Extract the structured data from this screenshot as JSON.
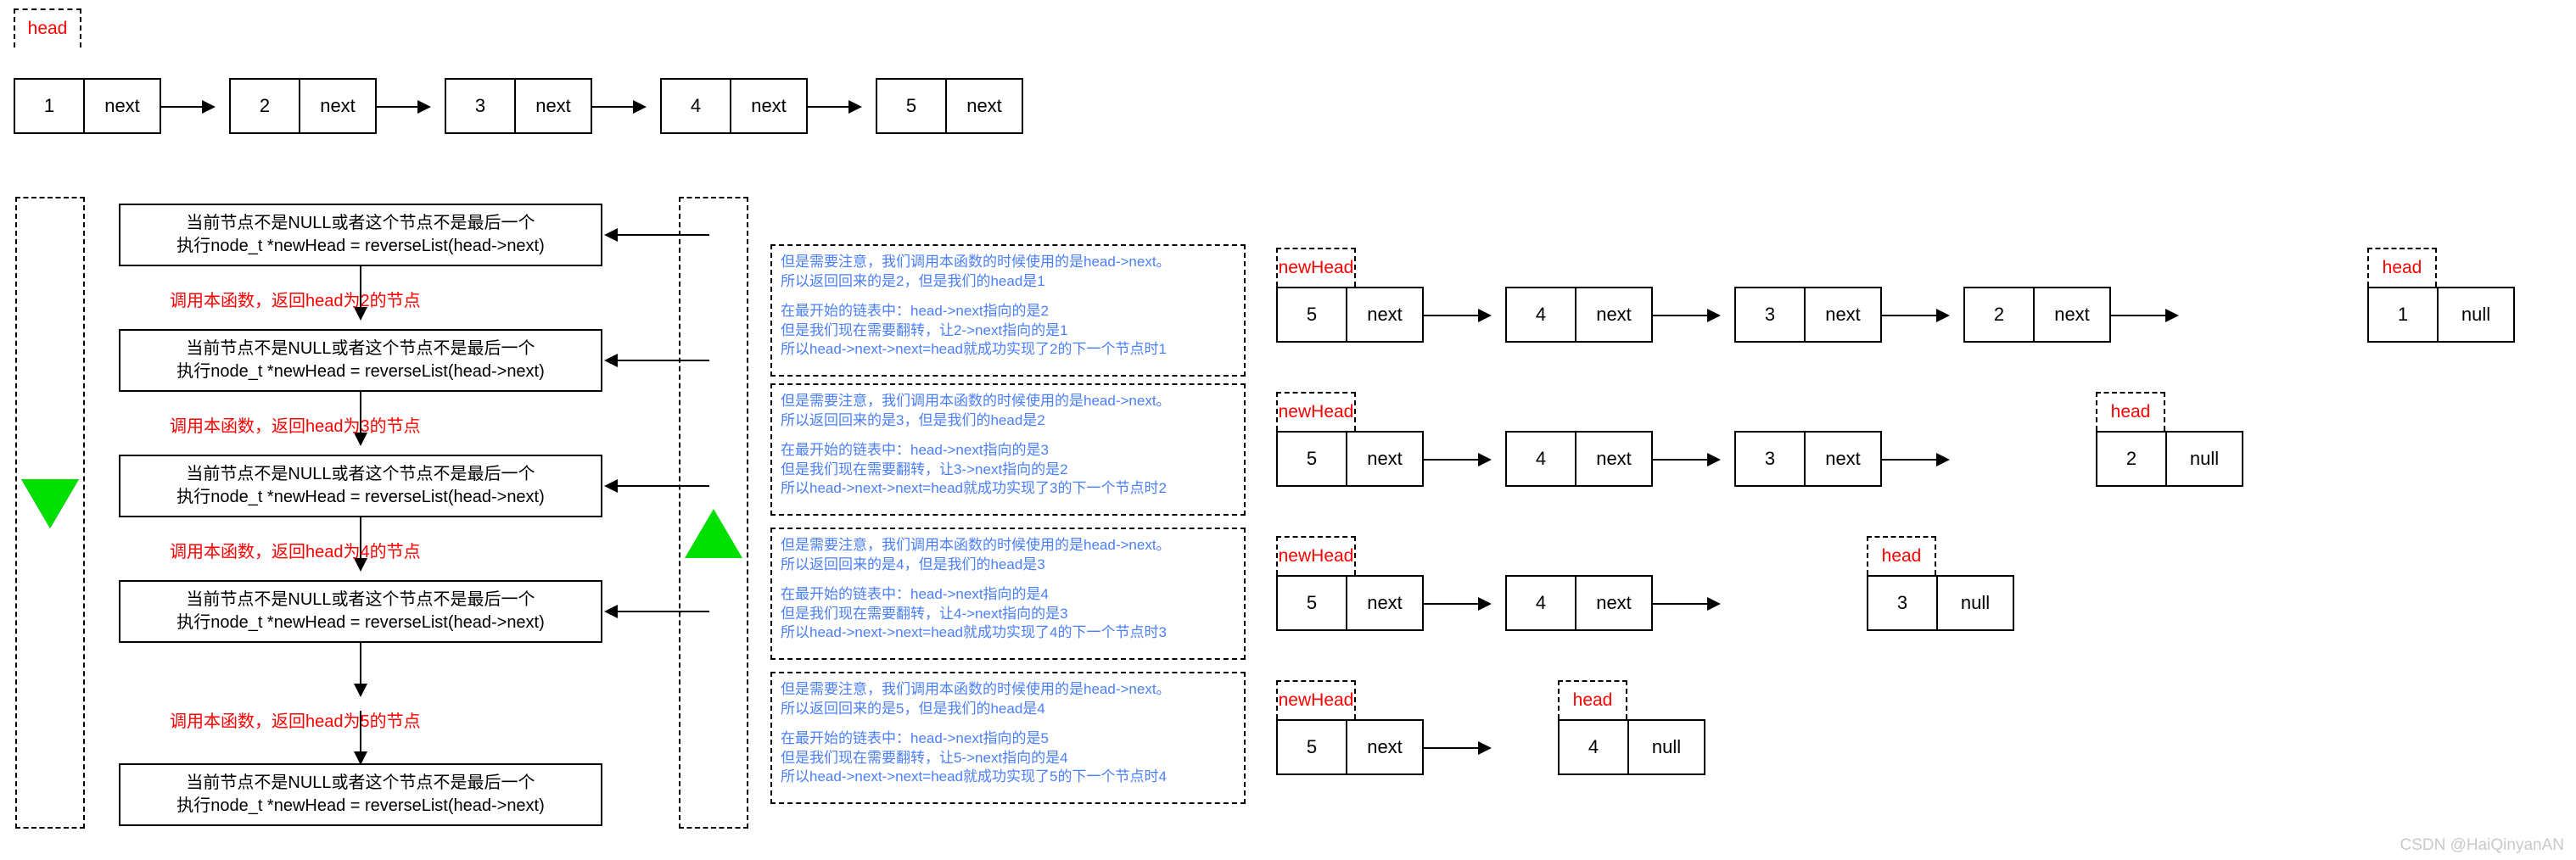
{
  "title": "reverseList recursion diagram",
  "colors": {
    "pointer_label": "#ff0000",
    "note_text": "#4a7ffb",
    "triangle": "#00e000",
    "outline": "#000000",
    "watermark": "#c9c9c9"
  },
  "top_list": {
    "pointer_label": "head",
    "nodes": [
      {
        "value": "1",
        "next": "next"
      },
      {
        "value": "2",
        "next": "next"
      },
      {
        "value": "3",
        "next": "next"
      },
      {
        "value": "4",
        "next": "next"
      },
      {
        "value": "5",
        "next": "next"
      }
    ]
  },
  "recursion": {
    "direction_icon_down": "triangle-down",
    "direction_icon_up": "triangle-up",
    "steps": [
      {
        "line1": "当前节点不是NULL或者这个节点不是最后一个",
        "line2": "执行node_t *newHead = reverseList(head->next)"
      },
      {
        "line1": "当前节点不是NULL或者这个节点不是最后一个",
        "line2": "执行node_t *newHead = reverseList(head->next)"
      },
      {
        "line1": "当前节点不是NULL或者这个节点不是最后一个",
        "line2": "执行node_t *newHead = reverseList(head->next)"
      },
      {
        "line1": "当前节点不是NULL或者这个节点不是最后一个",
        "line2": "执行node_t *newHead = reverseList(head->next)"
      },
      {
        "line1": "当前节点不是NULL或者这个节点不是最后一个",
        "line2": "执行node_t *newHead = reverseList(head->next)"
      }
    ],
    "transitions": [
      "调用本函数，返回head为2的节点",
      "调用本函数，返回head为3的节点",
      "调用本函数，返回head为4的节点",
      "调用本函数，返回head为5的节点"
    ]
  },
  "notes": [
    {
      "l1": "但是需要注意，我们调用本函数的时候使用的是head->next。",
      "l2": "所以返回回来的是2，但是我们的head是1",
      "l3": "在最开始的链表中：head->next指向的是2",
      "l4": "但是我们现在需要翻转，让2->next指向的是1",
      "l5": "所以head->next->next=head就成功实现了2的下一个节点时1"
    },
    {
      "l1": "但是需要注意，我们调用本函数的时候使用的是head->next。",
      "l2": "所以返回回来的是3，但是我们的head是2",
      "l3": "在最开始的链表中：head->next指向的是3",
      "l4": "但是我们现在需要翻转，让3->next指向的是2",
      "l5": "所以head->next->next=head就成功实现了3的下一个节点时2"
    },
    {
      "l1": "但是需要注意，我们调用本函数的时候使用的是head->next。",
      "l2": "所以返回回来的是4，但是我们的head是3",
      "l3": "在最开始的链表中：head->next指向的是4",
      "l4": "但是我们现在需要翻转，让4->next指向的是3",
      "l5": "所以head->next->next=head就成功实现了4的下一个节点时3"
    },
    {
      "l1": "但是需要注意，我们调用本函数的时候使用的是head->next。",
      "l2": "所以返回回来的是5，但是我们的head是4",
      "l3": "在最开始的链表中：head->next指向的是5",
      "l4": "但是我们现在需要翻转，让5->next指向的是4",
      "l5": "所以head->next->next=head就成功实现了5的下一个节点时4"
    }
  ],
  "result_lists": [
    {
      "new_head_label": "newHead",
      "head_label": "head",
      "nodes": [
        {
          "value": "5",
          "next": "next"
        },
        {
          "value": "4",
          "next": "next"
        },
        {
          "value": "3",
          "next": "next"
        },
        {
          "value": "2",
          "next": "next"
        },
        {
          "value": "1",
          "next": "null"
        }
      ]
    },
    {
      "new_head_label": "newHead",
      "head_label": "head",
      "nodes": [
        {
          "value": "5",
          "next": "next"
        },
        {
          "value": "4",
          "next": "next"
        },
        {
          "value": "3",
          "next": "next"
        },
        {
          "value": "2",
          "next": "null"
        }
      ]
    },
    {
      "new_head_label": "newHead",
      "head_label": "head",
      "nodes": [
        {
          "value": "5",
          "next": "next"
        },
        {
          "value": "4",
          "next": "next"
        },
        {
          "value": "3",
          "next": "null"
        }
      ]
    },
    {
      "new_head_label": "newHead",
      "head_label": "head",
      "nodes": [
        {
          "value": "5",
          "next": "next"
        },
        {
          "value": "4",
          "next": "null"
        }
      ]
    }
  ],
  "watermark": "CSDN @HaiQinyanAN"
}
